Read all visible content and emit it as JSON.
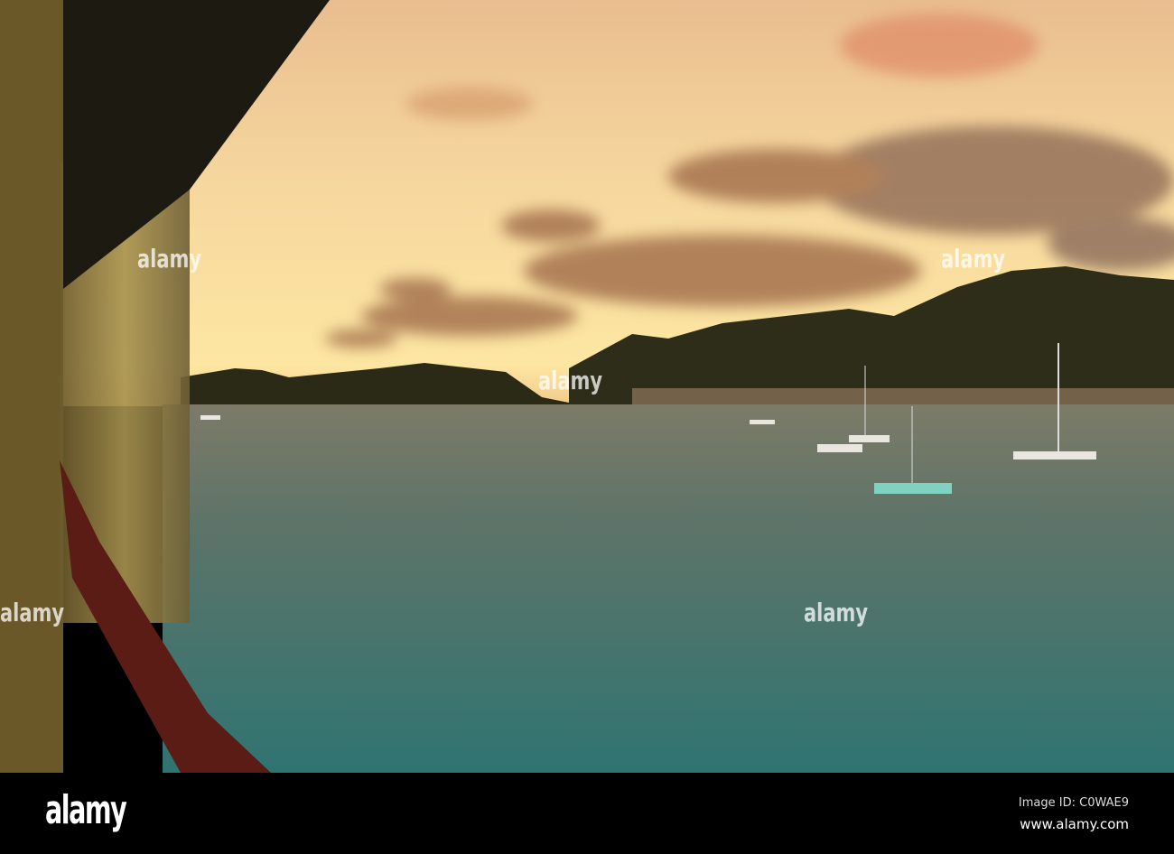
{
  "photo": {
    "description_alt": "Sunset over a harbor viewed from a cruise ship balcony",
    "colors": {
      "sky_top": "#efc79a",
      "sky_horizon": "#fbe3a0",
      "cloud": "#9a6a48",
      "hills": "#2b2a17",
      "water": "#3f6f6a"
    }
  },
  "watermark": {
    "text": "alamy"
  },
  "banner": {
    "logo": "alamy",
    "image_id": "Image ID: C0WAE9",
    "site": "www.alamy.com"
  }
}
